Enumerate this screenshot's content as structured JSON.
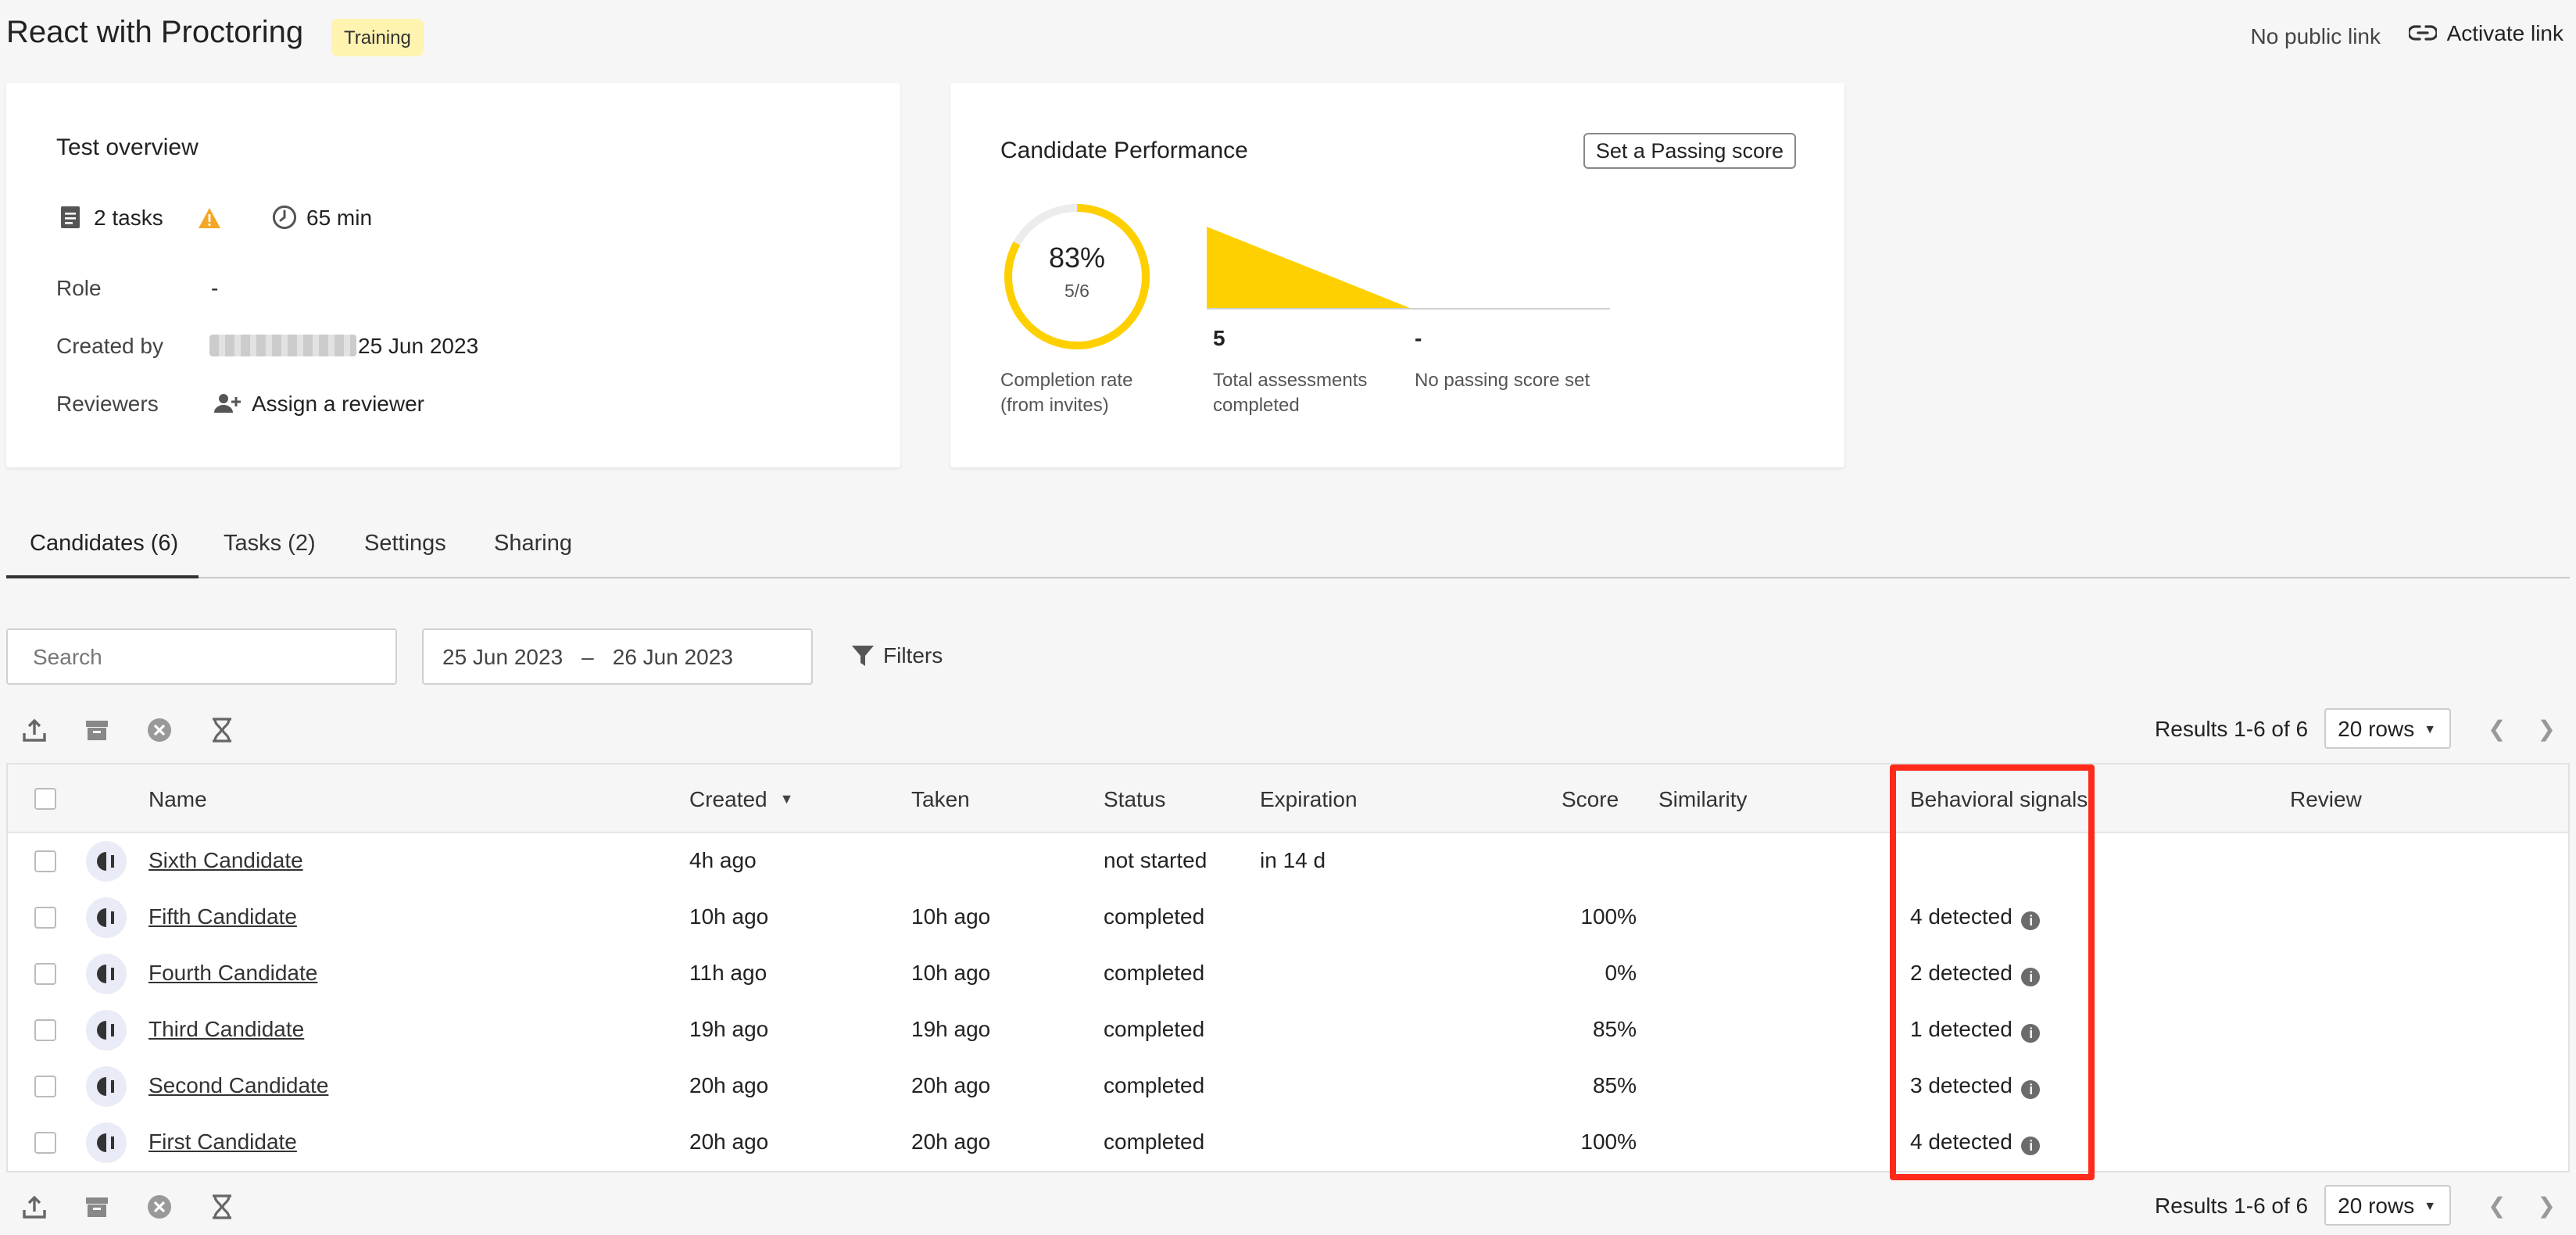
{
  "header": {
    "title": "React with Proctoring",
    "badge": "Training",
    "public_link_status": "No public link",
    "activate_link_label": "Activate link"
  },
  "overview": {
    "title": "Test overview",
    "tasks": "2 tasks",
    "duration": "65 min",
    "role_label": "Role",
    "role_value": "-",
    "created_by_label": "Created by",
    "created_date": "25 Jun 2023",
    "reviewers_label": "Reviewers",
    "assign_reviewer": "Assign a reviewer"
  },
  "performance": {
    "title": "Candidate Performance",
    "passing_score_button": "Set a Passing score",
    "completion_percent": "83%",
    "completion_fraction": "5/6",
    "completion_value": 0.83,
    "completion_label_1": "Completion rate",
    "completion_label_2": "(from invites)",
    "total_completed": "5",
    "total_label_1": "Total assessments",
    "total_label_2": "completed",
    "passing_value": "-",
    "passing_label": "No passing score set"
  },
  "tabs": [
    {
      "label": "Candidates (6)"
    },
    {
      "label": "Tasks (2)"
    },
    {
      "label": "Settings"
    },
    {
      "label": "Sharing"
    }
  ],
  "filters": {
    "search_placeholder": "Search",
    "date_from": "25 Jun 2023",
    "date_sep": "–",
    "date_to": "26 Jun 2023",
    "filters_label": "Filters"
  },
  "pagination": {
    "results_text": "Results 1-6 of 6",
    "rows_label": "20 rows"
  },
  "table": {
    "headers": {
      "name": "Name",
      "created": "Created",
      "taken": "Taken",
      "status": "Status",
      "expiration": "Expiration",
      "score": "Score",
      "similarity": "Similarity",
      "behavioral": "Behavioral signals",
      "review": "Review"
    },
    "rows": [
      {
        "name": "Sixth Candidate",
        "created": "4h ago",
        "taken": "",
        "status": "not started",
        "expiration": "in 14 d",
        "score": "",
        "behavioral": ""
      },
      {
        "name": "Fifth Candidate",
        "created": "10h ago",
        "taken": "10h ago",
        "status": "completed",
        "expiration": "",
        "score": "100%",
        "behavioral": "4 detected"
      },
      {
        "name": "Fourth Candidate",
        "created": "11h ago",
        "taken": "10h ago",
        "status": "completed",
        "expiration": "",
        "score": "0%",
        "behavioral": "2 detected"
      },
      {
        "name": "Third Candidate",
        "created": "19h ago",
        "taken": "19h ago",
        "status": "completed",
        "expiration": "",
        "score": "85%",
        "behavioral": "1 detected"
      },
      {
        "name": "Second Candidate",
        "created": "20h ago",
        "taken": "20h ago",
        "status": "completed",
        "expiration": "",
        "score": "85%",
        "behavioral": "3 detected"
      },
      {
        "name": "First Candidate",
        "created": "20h ago",
        "taken": "20h ago",
        "status": "completed",
        "expiration": "",
        "score": "100%",
        "behavioral": "4 detected"
      }
    ]
  },
  "colors": {
    "accent_yellow": "#ffd000",
    "highlight_red": "#ff2a1a",
    "badge_bg": "#fff3b0",
    "warning_orange": "#f5a623"
  }
}
